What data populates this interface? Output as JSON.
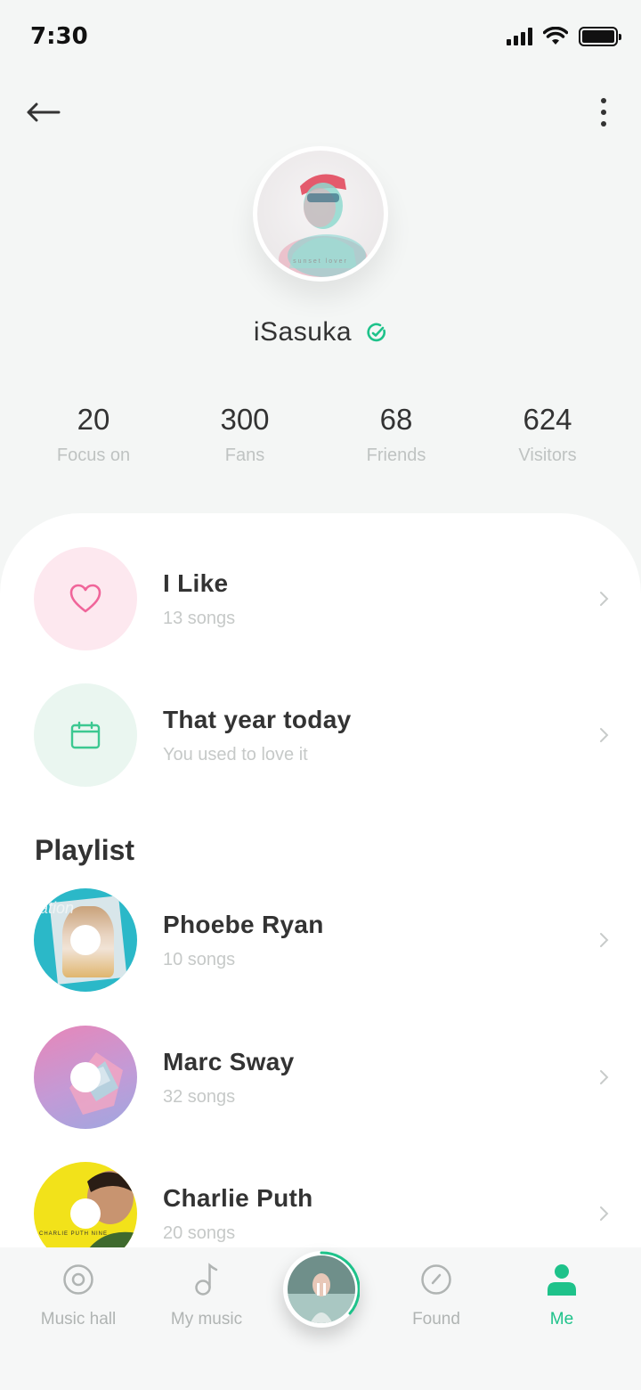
{
  "status": {
    "time": "7:30"
  },
  "profile": {
    "username": "iSasuka",
    "avatar_caption": "sunset lover"
  },
  "stats": [
    {
      "value": "20",
      "label": "Focus on"
    },
    {
      "value": "300",
      "label": "Fans"
    },
    {
      "value": "68",
      "label": "Friends"
    },
    {
      "value": "624",
      "label": "Visitors"
    }
  ],
  "quick_items": [
    {
      "title": "I Like",
      "subtitle": "13 songs",
      "icon": "heart-icon"
    },
    {
      "title": "That year today",
      "subtitle": "You used to love it",
      "icon": "calendar-icon"
    }
  ],
  "playlist": {
    "title": "Playlist",
    "items": [
      {
        "title": "Phoebe Ryan",
        "subtitle": "10 songs",
        "cover_text": "ation"
      },
      {
        "title": "Marc Sway",
        "subtitle": "32 songs"
      },
      {
        "title": "Charlie Puth",
        "subtitle": "20 songs",
        "cover_text": "CHARLIE PUTH NINE"
      }
    ]
  },
  "tabs": [
    {
      "label": "Music hall",
      "icon": "disc-icon"
    },
    {
      "label": "My music",
      "icon": "music-note-icon"
    },
    {
      "label": "Found",
      "icon": "compass-icon"
    },
    {
      "label": "Me",
      "icon": "user-icon"
    }
  ],
  "colors": {
    "accent": "#1ec28a",
    "heart": "#f0659a",
    "like_bg": "#fde8ef",
    "calendar_bg": "#eaf6f0"
  }
}
